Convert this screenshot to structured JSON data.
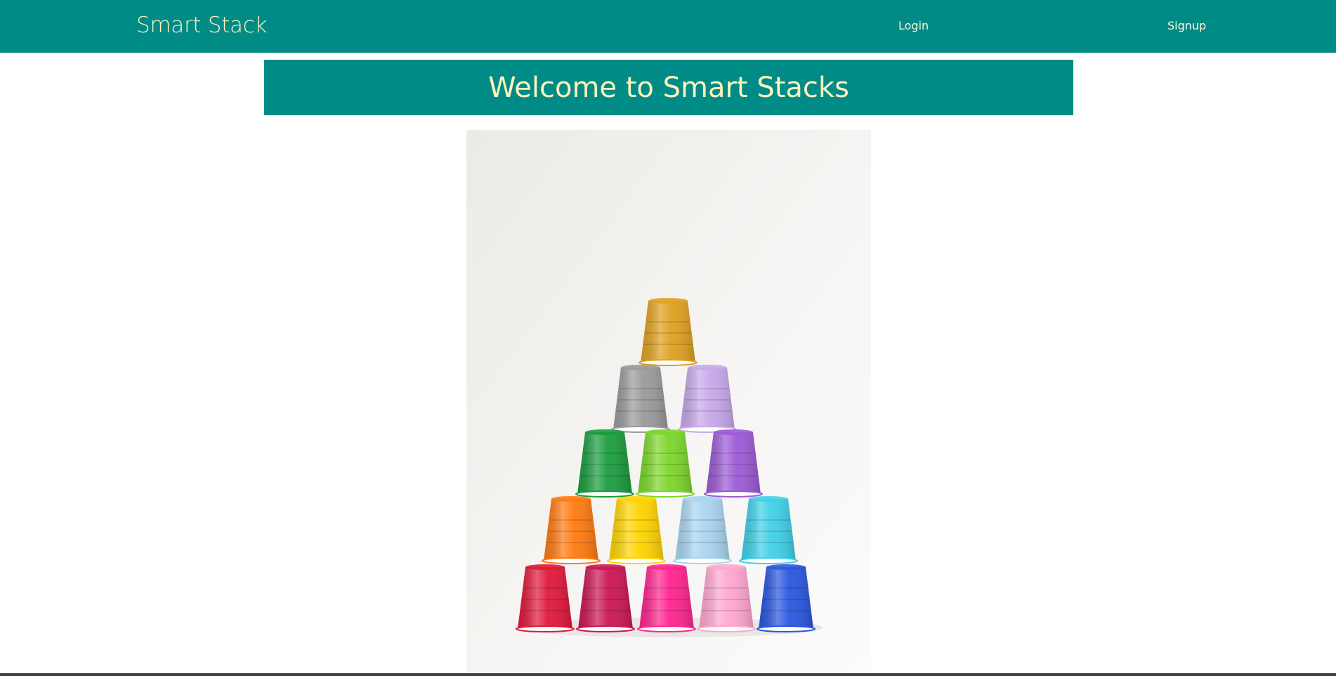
{
  "nav": {
    "brand": "Smart Stack",
    "links": [
      "Login",
      "Signup"
    ]
  },
  "banner": {
    "title": "Welcome to Smart Stacks"
  },
  "hero": {
    "subject": "pyramid of colorful plastic cups",
    "cup_colors": {
      "row1": [
        "#e0a020"
      ],
      "row2": [
        "#9a9a9a",
        "#c7a8ea"
      ],
      "row3": [
        "#1a9c3e",
        "#7cd62a",
        "#9c5ad6"
      ],
      "row4": [
        "#ff7a10",
        "#ffd400",
        "#a9d4f0",
        "#3fd0e8"
      ],
      "row5": [
        "#e0183a",
        "#cc1656",
        "#ff2490",
        "#ffa6cf",
        "#2a56e0"
      ]
    }
  },
  "colors": {
    "primary": "#008b86",
    "accent_text": "#fff2bd",
    "background": "#ffffff"
  }
}
